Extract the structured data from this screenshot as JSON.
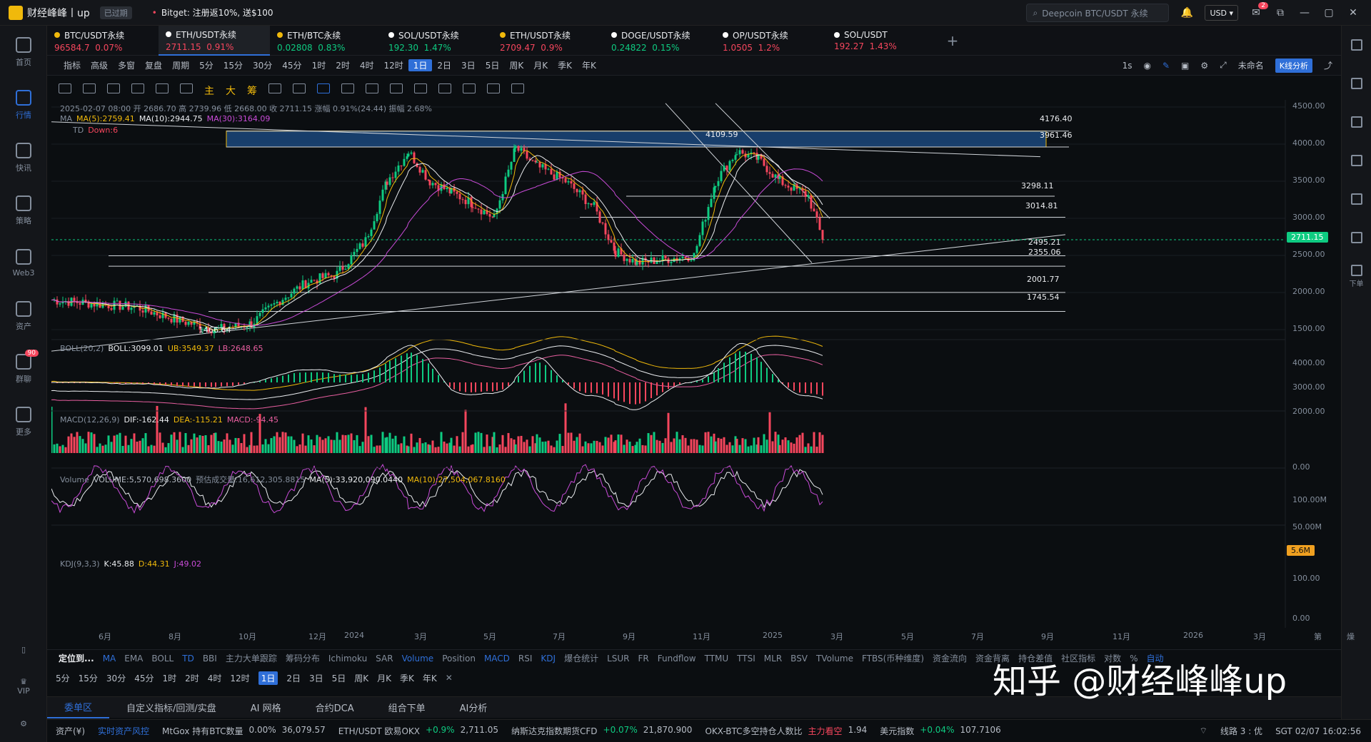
{
  "topbar": {
    "brand": "财经峰峰丨up",
    "expired": "已过期",
    "promo": "Bitget: 注册返10%, 送$100",
    "search_placeholder": "Deepcoin BTC/USDT 永续",
    "currency": "USD",
    "notif_badge": "2"
  },
  "sidebar": {
    "items": [
      {
        "label": "首页",
        "icon": "home-icon"
      },
      {
        "label": "行情",
        "icon": "chart-bar-icon",
        "active": true
      },
      {
        "label": "快讯",
        "icon": "news-icon"
      },
      {
        "label": "策略",
        "icon": "robot-icon"
      },
      {
        "label": "Web3",
        "icon": "web3-icon"
      },
      {
        "label": "资产",
        "icon": "wallet-icon"
      },
      {
        "label": "群聊",
        "icon": "chat-icon",
        "badge": "90"
      },
      {
        "label": "更多",
        "icon": "grid-icon"
      }
    ],
    "vip": "VIP"
  },
  "rsidebar": {
    "orders": "下单"
  },
  "tabs": [
    {
      "name": "BTC/USDT永续",
      "price": "96584.7",
      "change": "0.07%",
      "dir": "down",
      "dot": "#f0b90b"
    },
    {
      "name": "ETH/USDT永续",
      "price": "2711.15",
      "change": "0.91%",
      "dir": "down",
      "dot": "#ffffff"
    },
    {
      "name": "ETH/BTC永续",
      "price": "0.02808",
      "change": "0.83%",
      "dir": "up",
      "dot": "#f0b90b"
    },
    {
      "name": "SOL/USDT永续",
      "price": "192.30",
      "change": "1.47%",
      "dir": "up",
      "dot": "#ffffff"
    },
    {
      "name": "ETH/USDT永续",
      "price": "2709.47",
      "change": "0.9%",
      "dir": "down",
      "dot": "#f0b90b"
    },
    {
      "name": "DOGE/USDT永续",
      "price": "0.24822",
      "change": "0.15%",
      "dir": "up",
      "dot": "#ffffff"
    },
    {
      "name": "OP/USDT永续",
      "price": "1.0505",
      "change": "1.2%",
      "dir": "down",
      "dot": "#ffffff"
    },
    {
      "name": "SOL/USDT",
      "price": "192.27",
      "change": "1.43%",
      "dir": "down",
      "dot": "#ffffff"
    }
  ],
  "toolbar": {
    "items": [
      "指标",
      "高级",
      "多窗",
      "复盘",
      "周期",
      "5分",
      "15分",
      "30分",
      "45分",
      "1时",
      "2时",
      "4时",
      "12时",
      "1日",
      "2日",
      "3日",
      "5日",
      "周K",
      "月K",
      "季K",
      "年K"
    ],
    "selected": "1日",
    "right": [
      "1s",
      "未命名"
    ],
    "kline": "K线分析"
  },
  "drawtools": {
    "labels": [
      "主",
      "大",
      "筹"
    ]
  },
  "chart": {
    "ohlc": "2025-02-07 08:00  开 2686.70  高 2739.96  低 2668.00  收 2711.15  涨幅 0.91%(24.44)  振幅 2.68%",
    "ma": {
      "label": "MA",
      "ma5": "MA(5):2759.41",
      "ma10": "MA(10):2944.75",
      "ma30": "MA(30):3164.09"
    },
    "td": {
      "label": "TD",
      "value": "Down:6"
    },
    "price_axis": [
      "4500.00",
      "4000.00",
      "3500.00",
      "3000.00",
      "2500.00",
      "2000.00",
      "1500.00"
    ],
    "current_price": "2711.15",
    "levels": [
      "4176.40",
      "3961.46",
      "3298.11",
      "3014.81",
      "2495.21",
      "2355.06",
      "2001.77",
      "1745.54"
    ],
    "annotations": {
      "high": "4109.59",
      "low": "1466.64"
    },
    "boll": {
      "label": "BOLL(20,2)",
      "mid": "BOLL:3099.01",
      "ub": "UB:3549.37",
      "lb": "LB:2648.65",
      "axis": [
        "4000.00",
        "3000.00",
        "2000.00"
      ]
    },
    "macd": {
      "label": "MACD(12,26,9)",
      "dif": "DIF:-162.44",
      "dea": "DEA:-115.21",
      "macd": "MACD:-94.45",
      "axis": [
        "0.00"
      ]
    },
    "volume": {
      "label": "Volume",
      "vol": "VOLUME:5,570,698.3600",
      "est": "预估成交量:16,612,305.8815",
      "ma5": "MA(5):33,920,090.0440",
      "ma10": "MA(10):27,504,067.8160",
      "axis": [
        "100.00M",
        "50.00M"
      ],
      "tag": "5.6M"
    },
    "kdj": {
      "label": "KDJ(9,3,3)",
      "k": "K:45.88",
      "d": "D:44.31",
      "j": "J:49.02",
      "axis": [
        "100.00",
        "0.00"
      ]
    },
    "xaxis": [
      "6月",
      "8月",
      "10月",
      "12月",
      "2024",
      "3月",
      "5月",
      "7月",
      "9月",
      "11月",
      "2025",
      "3月",
      "5月",
      "7月",
      "9月",
      "11月",
      "2026",
      "3月",
      "第",
      "燥"
    ]
  },
  "indicators": {
    "items": [
      "定位到...",
      "MA",
      "EMA",
      "BOLL",
      "TD",
      "BBI",
      "主力大单跟踪",
      "筹码分布",
      "Ichimoku",
      "SAR",
      "Volume",
      "Position",
      "MACD",
      "RSI",
      "KDJ",
      "爆仓统计",
      "LSUR",
      "FR",
      "Fundflow",
      "TTMU",
      "TTSI",
      "MLR",
      "BSV",
      "TVolume",
      "FTBS(币种维度)",
      "资金流向",
      "资金背离",
      "持仓差值",
      "社区指标",
      "对数",
      "%",
      "自动"
    ],
    "active": [
      "MA",
      "TD",
      "Volume",
      "MACD",
      "KDJ",
      "自动"
    ]
  },
  "periods": {
    "items": [
      "5分",
      "15分",
      "30分",
      "45分",
      "1时",
      "2时",
      "4时",
      "12时",
      "1日",
      "2日",
      "3日",
      "5日",
      "周K",
      "月K",
      "季K",
      "年K"
    ],
    "selected": "1日"
  },
  "orders": {
    "tabs": [
      "委单区",
      "自定义指标/回测/实盘",
      "AI 网格",
      "合约DCA",
      "组合下单",
      "AI分析"
    ],
    "active": "委单区"
  },
  "status": {
    "asset": "资产(¥)",
    "risk": "实时资产风控",
    "items": [
      {
        "name": "MtGox 持有BTC数量",
        "chg": "0.00%",
        "val": "36,079.57"
      },
      {
        "name": "ETH/USDT 欧易OKX",
        "chg": "+0.9%",
        "val": "2,711.05"
      },
      {
        "name": "纳斯达克指数期货CFD",
        "chg": "+0.07%",
        "val": "21,870.900"
      },
      {
        "name": "OKX-BTC多空持仓人数比",
        "chg": "主力看空",
        "val": "1.94"
      },
      {
        "name": "美元指数",
        "chg": "+0.04%",
        "val": "107.7106"
      }
    ],
    "line": "线路 3 : 优",
    "time": "SGT 02/07 16:02:56"
  },
  "watermark": "知乎 @财经峰峰up",
  "colors": {
    "bg": "#0b0e11",
    "accent": "#2f6fd8",
    "up": "#0ecb81",
    "down": "#f6465d",
    "yellow": "#f0b90b"
  }
}
